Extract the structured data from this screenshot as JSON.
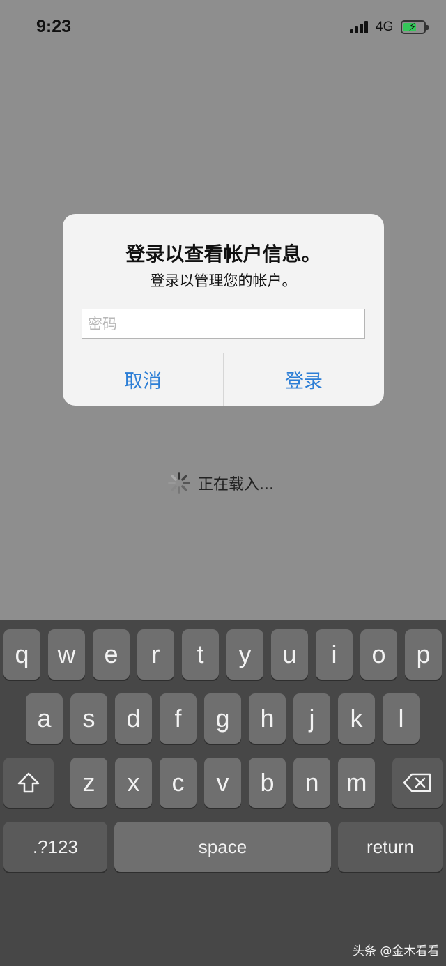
{
  "status_bar": {
    "time": "9:23",
    "network": "4G",
    "battery_level": 0.55,
    "battery_charging": true,
    "icons": [
      "signal-icon",
      "battery-icon",
      "charging-bolt-icon"
    ]
  },
  "alert": {
    "title": "登录以查看帐户信息。",
    "message": "登录以管理您的帐户。",
    "password_placeholder": "密码",
    "password_value": "",
    "cancel_label": "取消",
    "login_label": "登录",
    "accent_color": "#2c7ed6"
  },
  "loading": {
    "text": "正在载入...",
    "icon": "spinner-icon"
  },
  "keyboard": {
    "row1": [
      "q",
      "w",
      "e",
      "r",
      "t",
      "y",
      "u",
      "i",
      "o",
      "p"
    ],
    "row2": [
      "a",
      "s",
      "d",
      "f",
      "g",
      "h",
      "j",
      "k",
      "l"
    ],
    "row3": [
      "z",
      "x",
      "c",
      "v",
      "b",
      "n",
      "m"
    ],
    "shift_icon": "shift-icon",
    "delete_icon": "delete-icon",
    "numbers_label": ".?123",
    "space_label": "space",
    "return_label": "return"
  },
  "watermark": "头条 @金木看看"
}
